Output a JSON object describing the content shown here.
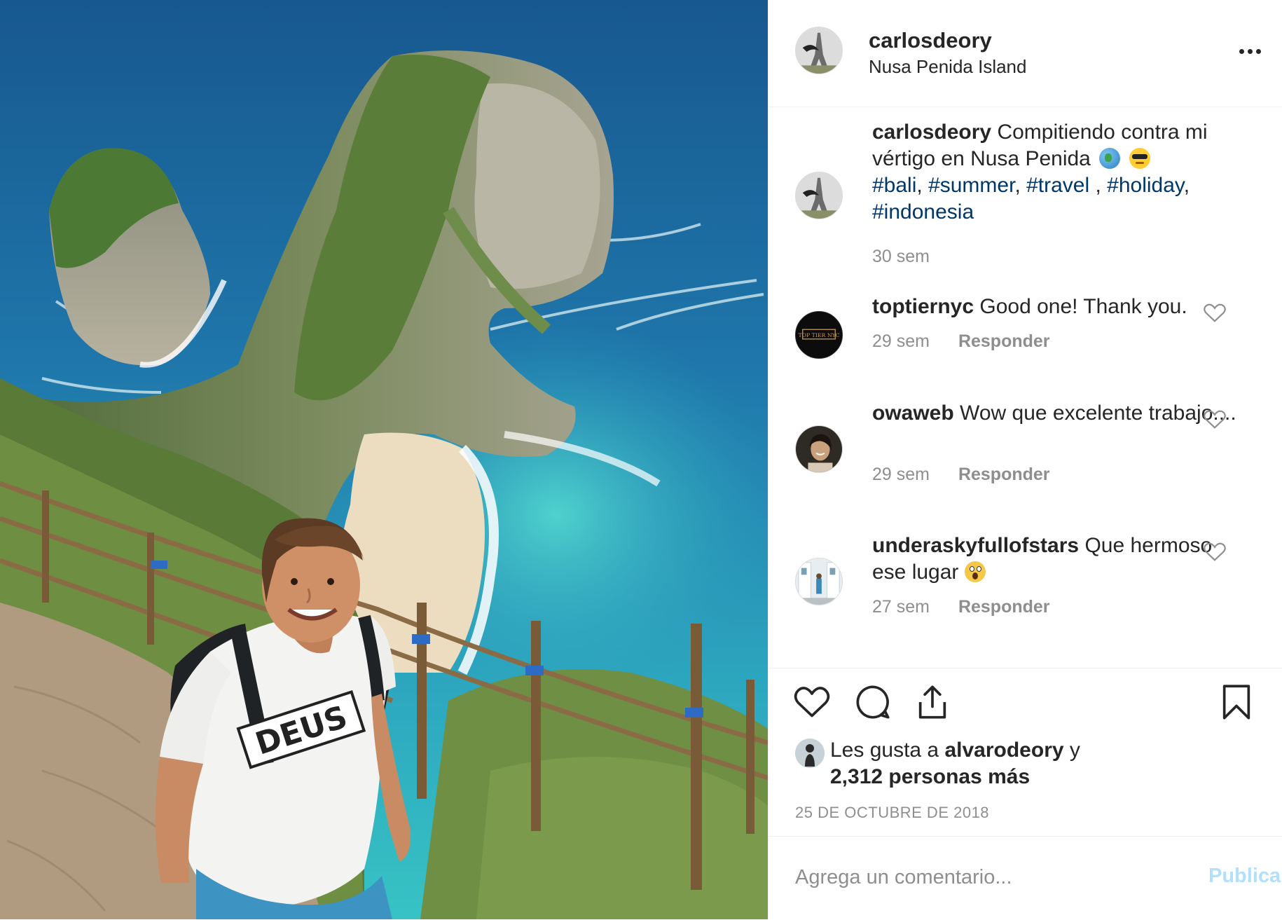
{
  "post": {
    "username": "carlosdeory",
    "location": "Nusa Penida Island",
    "photo_alt": "Kelingking beach selfie"
  },
  "caption": {
    "username": "carlosdeory",
    "text_1": "Compitiendo contra mi vértigo en Nusa Penida",
    "hashtags": [
      "#bali",
      "#summer",
      "#travel",
      "#holiday",
      "#indonesia"
    ],
    "time": "30 sem"
  },
  "comments": [
    {
      "username": "toptiernyc",
      "text": "Good one! Thank you.",
      "time": "29 sem",
      "reply": "Responder",
      "avatar_icon": "toptier-logo-icon"
    },
    {
      "username": "owaweb",
      "text": "Wow que excelente trabajo....",
      "time": "29 sem",
      "reply": "Responder",
      "avatar_icon": "person-photo-icon"
    },
    {
      "username": "underaskyfullofstars",
      "text": "Que hermoso ese lugar",
      "time": "27 sem",
      "reply": "Responder",
      "avatar_icon": "street-photo-icon"
    }
  ],
  "actions": {
    "icons": [
      "heart-icon",
      "comment-icon",
      "share-icon",
      "bookmark-icon"
    ]
  },
  "likes": {
    "prefix": "Les gusta a",
    "user": "alvarodeory",
    "connector": "y",
    "count_text": "2,312 personas más"
  },
  "date": "25 DE OCTUBRE DE 2018",
  "add_comment": {
    "placeholder": "Agrega un comentario...",
    "publish_label": "Publicar"
  },
  "colors": {
    "hashtag": "#00376b",
    "muted": "#8e8e8e",
    "publish_disabled": "#b2dffc",
    "text": "#262626",
    "border": "#efefef"
  }
}
